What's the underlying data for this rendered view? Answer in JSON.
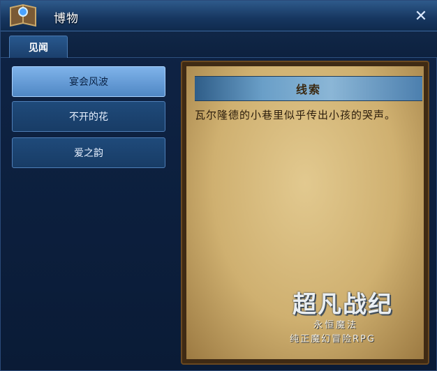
{
  "window": {
    "title": "博物",
    "close_icon": "close-icon"
  },
  "tabs": [
    {
      "label": "见闻",
      "active": true
    }
  ],
  "list": {
    "items": [
      {
        "label": "宴会风波",
        "selected": true
      },
      {
        "label": "不开的花",
        "selected": false
      },
      {
        "label": "爱之韵",
        "selected": false
      }
    ]
  },
  "clue": {
    "heading": "线索",
    "text": "瓦尔隆德的小巷里似乎传出小孩的哭声。"
  },
  "logo": {
    "main": "超凡战纪",
    "sub1": "永恒魔法",
    "sub2": "纯正魔幻冒险RPG"
  },
  "colors": {
    "accent_blue": "#4f87c4",
    "parchment": "#cfb070",
    "ribbon": "#6a9fc8"
  }
}
